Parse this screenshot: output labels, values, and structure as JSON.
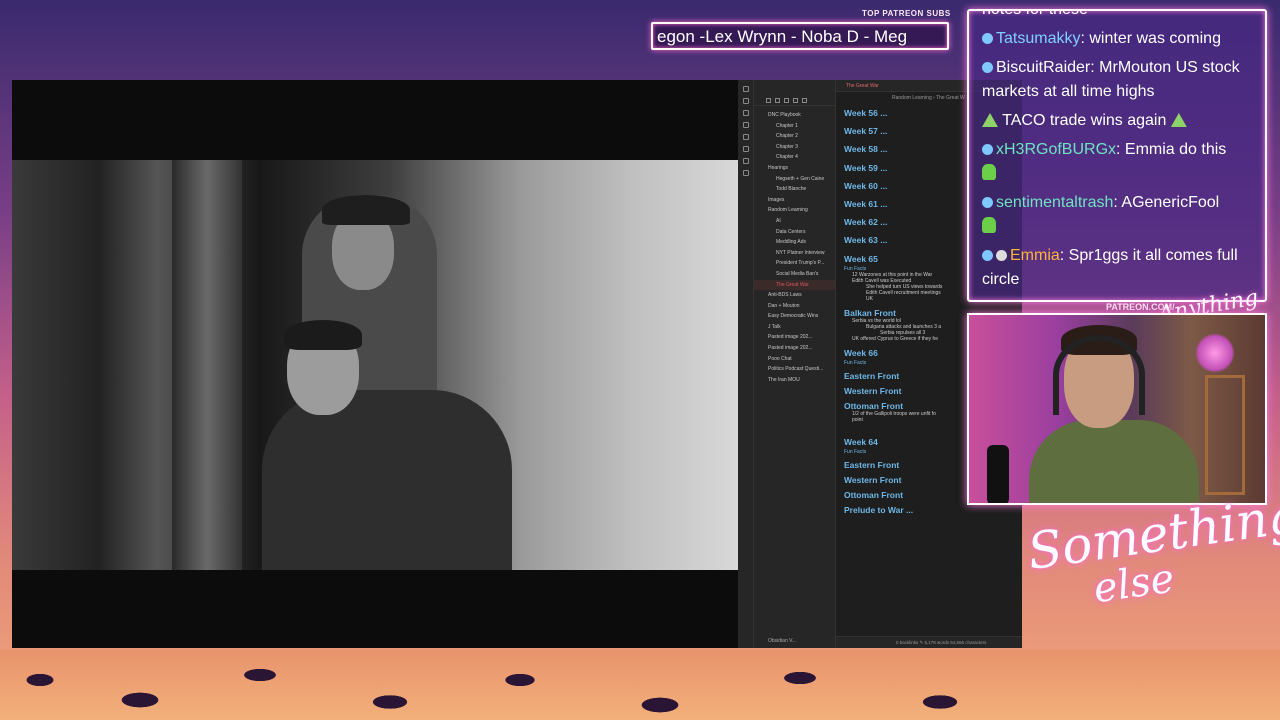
{
  "patreon": {
    "label": "TOP PATREON SUBS",
    "ticker": "egon -Lex Wrynn -  Noba D - Meg"
  },
  "obsidian": {
    "tab_title": "The Great War",
    "breadcrumb": "Random Learning  ›  The Great W",
    "tree": [
      "DNC Playbook",
      "Chapter 1",
      "Chapter 2",
      "Chapter 3",
      "Chapter 4",
      "Hearings",
      "Hegseth + Gen Caine",
      "Todd Blanche",
      "Images",
      "Random Learning",
      "AI",
      "Data Centers",
      "Meddling Ads",
      "NYT Platner Interview",
      "President Trump's P...",
      "Social Media Ban's",
      "The Great War",
      "Anti-BDS Laws",
      "Dan + Mouton",
      "Easy Democratic Wins",
      "J Talk",
      "Pasted image 202...",
      "Pasted image 202...",
      "Pooo Chat",
      "Politics Podcast Questi...",
      "The Iran MOU"
    ],
    "vault_name": "Obsidian V...",
    "note": {
      "w56": "Week 56 ...",
      "w57": "Week 57 ...",
      "w58": "Week 58 ...",
      "w59": "Week 59 ...",
      "w60": "Week 60 ...",
      "w61": "Week 61 ...",
      "w62": "Week 62 ...",
      "w63": "Week 63 ...",
      "w65": "Week 65",
      "fun_facts": "Fun Facts",
      "b1": "12 Warzones at this point in the War",
      "b2": "Edith Cavell was Executed",
      "b3": "She helped turn US views towards",
      "b4": "Edith Cavell recruitment meetings",
      "b5": "UK",
      "balkan": "Balkan Front",
      "b6": "Serbia vs the world lol",
      "b7": "Bulgaria attacks and launches 3 a",
      "b8": "Serbia repulses all 3",
      "b9": "UK offered Cyprus to Greece if they he",
      "w66": "Week 66",
      "fun_facts2": "Fun Facts",
      "eastern": "Eastern Front",
      "western": "Western Front",
      "ottoman": "Ottoman Front",
      "b10": "1/2 of the Gallipoli troops were unfit fo",
      "b11": "point",
      "w64": "Week 64",
      "fun_facts3": "Fun Facts",
      "eastern2": "Eastern Front",
      "western2": "Western Front",
      "ottoman2": "Ottoman Front",
      "prelude": "Prelude to War ..."
    },
    "status": "0 backlinks   ✎   5,178 words   54,566 characters"
  },
  "chat": [
    {
      "user": "",
      "msg": "notes for these",
      "user_color": "#ffffff"
    },
    {
      "user": "Tatsumakky",
      "msg": ": winter was coming",
      "user_color": "#7fd0ff"
    },
    {
      "user": "BiscuitRaider",
      "msg": ": MrMouton US stock markets at all time highs",
      "user_color": "#ffffff"
    },
    {
      "user": "",
      "msg": " TACO trade wins again ",
      "user_color": "#ffffff"
    },
    {
      "user": "xH3RGofBURGx",
      "msg": ": Emmia do this",
      "user_color": "#6fe3c2"
    },
    {
      "user": "sentimentaltrash",
      "msg": ": AGenericFool",
      "user_color": "#6fe3c2"
    },
    {
      "user": "Emmia",
      "msg": ": Spr1ggs it all comes full circle",
      "user_color": "#ffb43a"
    }
  ],
  "cam": {
    "label": "PATREON.COM/",
    "brand": "Anything Else?"
  },
  "signature": {
    "line1": "Something",
    "line2": "else"
  }
}
